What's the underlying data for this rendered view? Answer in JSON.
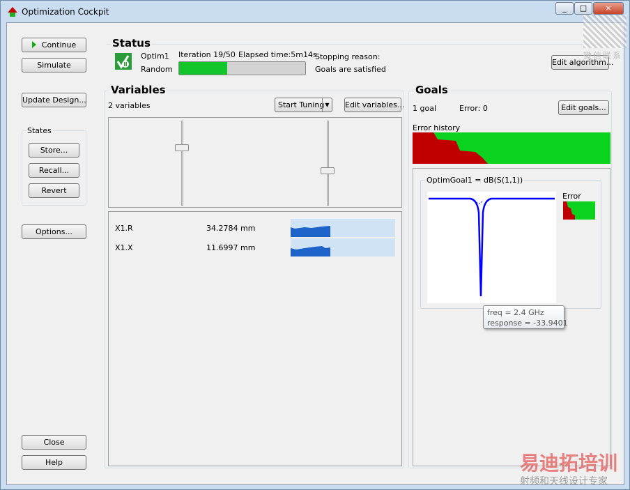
{
  "window": {
    "title": "Optimization Cockpit",
    "controls": [
      "_",
      "□",
      "×"
    ]
  },
  "left": {
    "continue": "Continue",
    "simulate": "Simulate",
    "update_design": "Update Design...",
    "states_label": "States",
    "store": "Store...",
    "recall": "Recall...",
    "revert": "Revert",
    "options": "Options...",
    "close": "Close",
    "help": "Help"
  },
  "status": {
    "heading": "Status",
    "name": "Optim1",
    "method": "Random",
    "iteration": "Iteration 19/50",
    "elapsed": "Elapsed time:5m14s",
    "progress": 0.38,
    "stopping_label": "Stopping reason:",
    "stopping_value": "Goals are satisfied",
    "edit_algorithm": "Edit algorithm..."
  },
  "variables": {
    "heading": "Variables",
    "count": "2 variables",
    "start_tuning": "Start Tuning",
    "edit": "Edit variables...",
    "slider_positions": [
      0.3,
      0.6
    ],
    "rows": [
      {
        "name": "X1.R",
        "value": "34.2784 mm"
      },
      {
        "name": "X1.X",
        "value": "11.6997 mm"
      }
    ]
  },
  "goals": {
    "heading": "Goals",
    "count": "1 goal",
    "error": "Error:  0",
    "edit": "Edit goals...",
    "error_history": "Error history",
    "plot_title": "OptimGoal1 = dB(S(1,1))",
    "error_label": "Error",
    "tooltip": {
      "freq": "freq = 2.4 GHz",
      "response": "response = -33.9401"
    }
  },
  "watermark": {
    "top": "微信联系",
    "brand": "易迪拓培训",
    "tagline": "射频和天线设计专家"
  },
  "colors": {
    "green": "#00c000",
    "red": "#c00000",
    "blue": "#0000ff"
  }
}
